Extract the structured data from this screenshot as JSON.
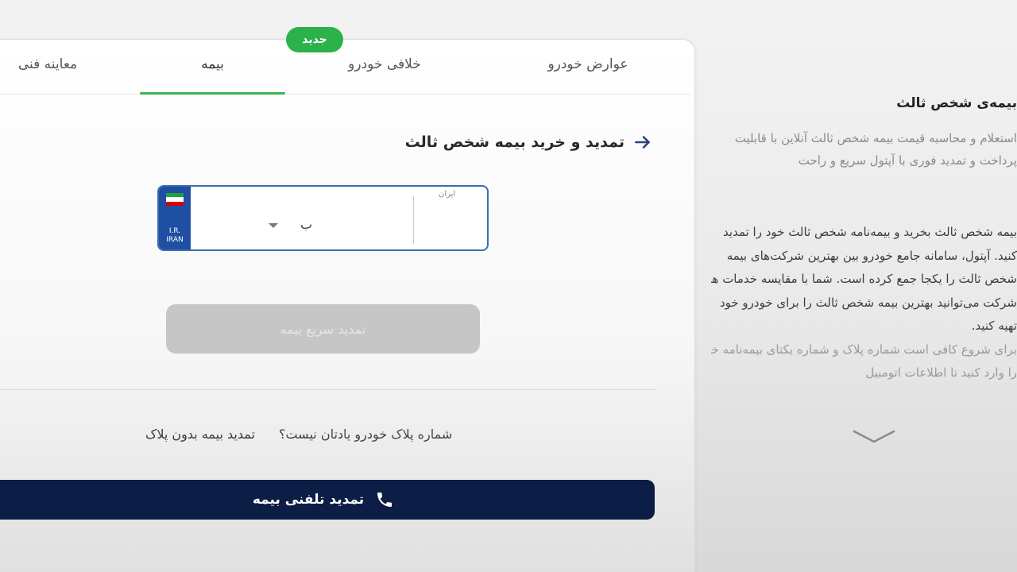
{
  "tabs": [
    {
      "label": "عوارض خودرو"
    },
    {
      "label": "خلافی خودرو"
    },
    {
      "label": "بیمه"
    },
    {
      "label": "معاینه فنی"
    }
  ],
  "active_tab": "بیمه",
  "badge": {
    "label": "جدید"
  },
  "form": {
    "heading": "تمدید و خرید بیمه شخص ثالث",
    "plate": {
      "country_line1": "I.R.",
      "country_line2": "IRAN",
      "iran_label": "ایران",
      "letter": "ب"
    },
    "quick_renew_button": "تمدید سریع بیمه"
  },
  "hint": {
    "question": "شماره پلاک خودرو یادتان نیست؟",
    "link": "تمدید بیمه بدون پلاک"
  },
  "phone_button": {
    "label": "تمدید تلفنی بیمه"
  },
  "side": {
    "title": "بیمه‌ی شخص ثالث",
    "intro": "استعلام و محاسبه قیمت بیمه شخص ثالث آنلاین با قابلیت پرداخت و تمدید فوری با آپتول سریع و راحت",
    "body": "بیمه شخص ثالث بخرید و بیمه‌نامه شخص ثالث خود را تمدید کنید. آپتول، سامانه جامع خودرو بین بهترین شرکت‌های بیمه شخص ثالث را یکجا جمع کرده است. شما با مقایسه خدمات هر شرکت می‌توانید بهترین بیمه شخص ثالث را برای خودرو خود تهیه کنید.",
    "body2": "برای شروع کافی است شماره پلاک و شماره یکتای بیمه‌نامه خود را وارد کنید تا اطلاعات اتومبیل"
  },
  "colors": {
    "accent_green": "#2bb24a",
    "navy": "#0d1e46",
    "plate_blue": "#1f4fa3",
    "disabled_button": "#c6c6c6"
  },
  "icons": {
    "heading_arrow": "arrow-right-icon",
    "phone": "phone-icon",
    "expand": "chevron-down-icon",
    "flag": "iran-flag-icon"
  }
}
